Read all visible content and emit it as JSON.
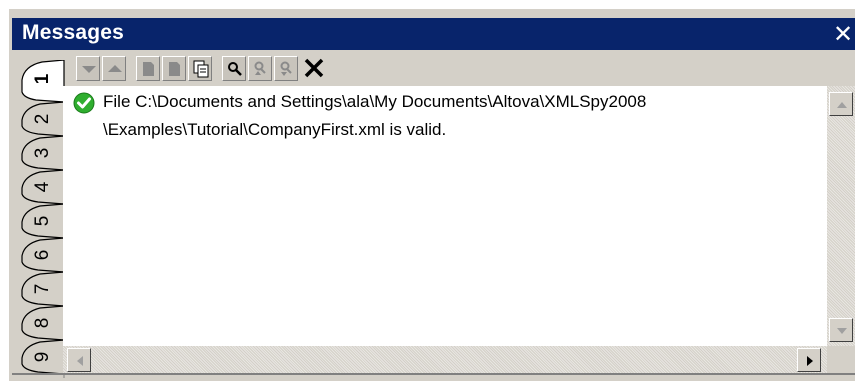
{
  "window": {
    "title": "Messages",
    "close_glyph": "✕"
  },
  "toolbar": {
    "buttons": [
      {
        "name": "next-message-icon",
        "enabled": false
      },
      {
        "name": "previous-message-icon",
        "enabled": false
      },
      {
        "name": "copy-message-icon",
        "enabled": false
      },
      {
        "name": "copy-with-children-icon",
        "enabled": false
      },
      {
        "name": "copy-all-icon",
        "enabled": true
      },
      {
        "name": "find-icon",
        "enabled": true
      },
      {
        "name": "find-previous-icon",
        "enabled": false
      },
      {
        "name": "find-next-icon",
        "enabled": false
      },
      {
        "name": "clear-icon",
        "enabled": true
      }
    ]
  },
  "tabs": [
    "1",
    "2",
    "3",
    "4",
    "5",
    "6",
    "7",
    "8",
    "9"
  ],
  "active_tab": "1",
  "message": {
    "status_icon": "valid-check-icon",
    "line1": "File C:\\Documents and Settings\\ala\\My Documents\\Altova\\XMLSpy2008",
    "line2": "\\Examples\\Tutorial\\CompanyFirst.xml is valid."
  },
  "colors": {
    "title_bar": "#08246b",
    "chrome": "#d4d0c8",
    "valid_green": "#2fae2f"
  }
}
